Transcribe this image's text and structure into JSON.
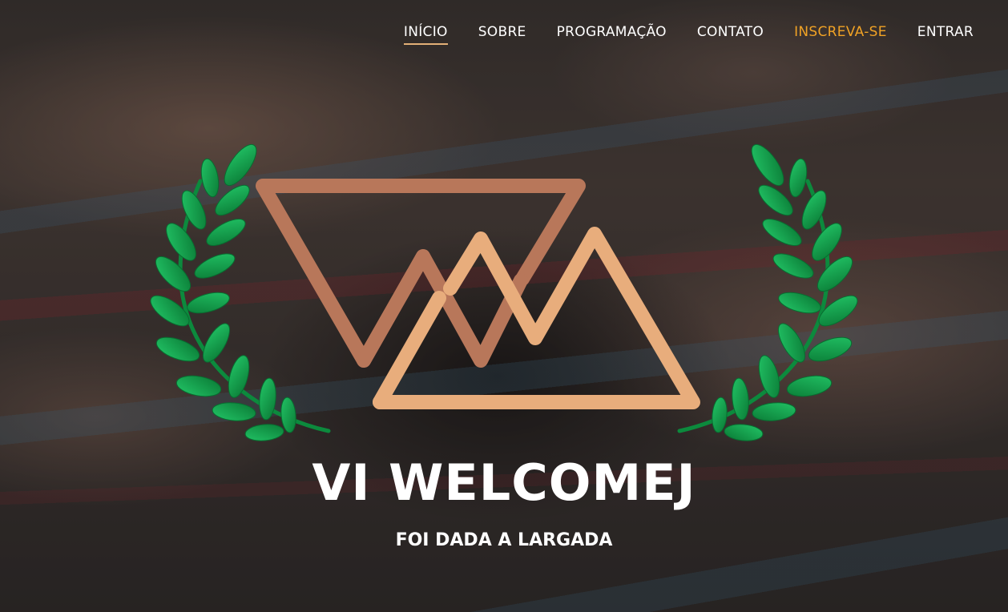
{
  "nav": {
    "items": [
      {
        "label": "INÍCIO",
        "state": "active"
      },
      {
        "label": "SOBRE",
        "state": "normal"
      },
      {
        "label": "PROGRAMAÇÃO",
        "state": "normal"
      },
      {
        "label": "CONTATO",
        "state": "normal"
      },
      {
        "label": "INSCREVA-SE",
        "state": "highlight"
      },
      {
        "label": "ENTRAR",
        "state": "normal"
      }
    ]
  },
  "hero": {
    "title": "VI WELCOMEJ",
    "subtitle": "FOI DADA A LARGADA"
  },
  "emblem": {
    "icons": [
      "laurel-wreath-icon",
      "wm-triangle-logo-icon"
    ]
  },
  "colors": {
    "nav_text": "#ffffff",
    "nav_highlight": "#f0a225",
    "nav_active_underline": "#e3b077",
    "logo_dark": "#b8775a",
    "logo_light": "#e8ad7c",
    "laurel": "#0f9a45"
  }
}
